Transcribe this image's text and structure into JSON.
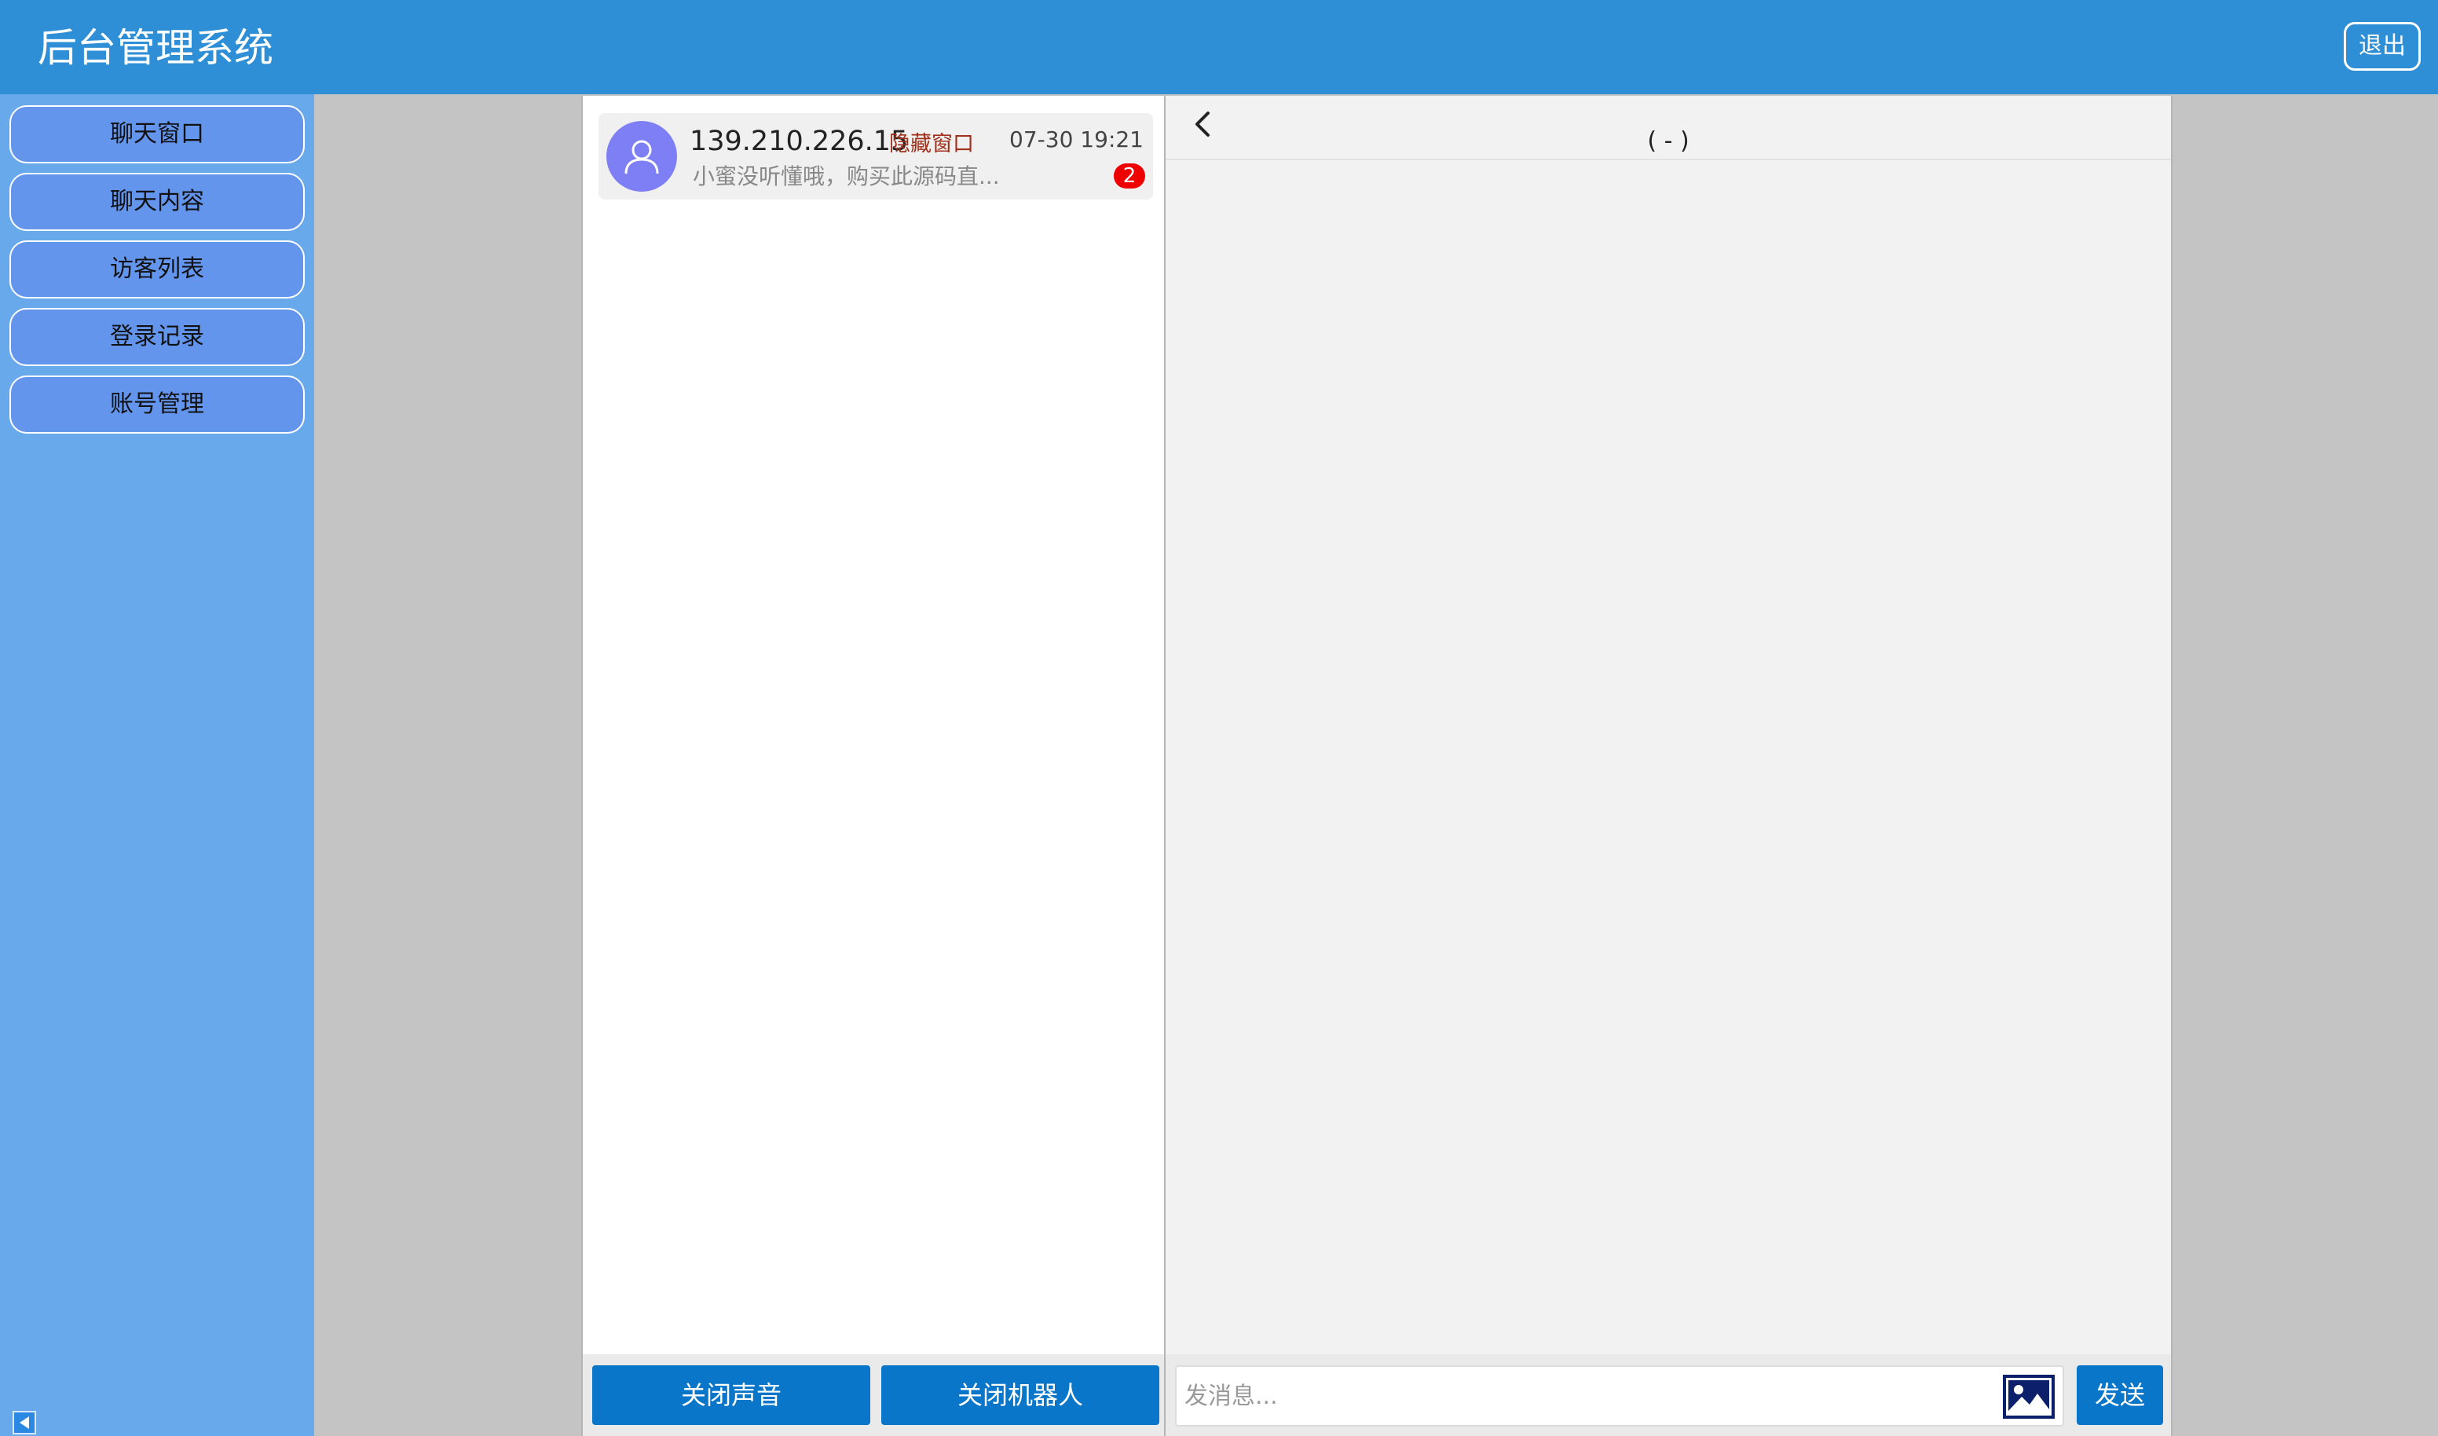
{
  "header": {
    "title": "后台管理系统",
    "logout_label": "退出"
  },
  "sidebar": {
    "items": [
      {
        "label": "聊天窗口"
      },
      {
        "label": "聊天内容"
      },
      {
        "label": "访客列表"
      },
      {
        "label": "登录记录"
      },
      {
        "label": "账号管理"
      }
    ],
    "collapse_icon": "triangle-left-icon"
  },
  "conversations": [
    {
      "ip": "139.210.226.15",
      "hide_label": "隐藏窗口",
      "time": "07-30 19:21",
      "preview": "小蜜没听懂哦，购买此源码直...",
      "unread": "2",
      "avatar_icon": "user-icon",
      "avatar_color": "#7f7ff5"
    }
  ],
  "list_footer": {
    "mute_label": "关闭声音",
    "robot_label": "关闭机器人"
  },
  "chat": {
    "title": "( - )",
    "back_icon": "chevron-left-icon",
    "input_placeholder": "发消息...",
    "image_icon": "image-icon",
    "send_label": "发送"
  },
  "colors": {
    "header_bg": "#2f8fd6",
    "sidebar_bg": "#68a9ec",
    "nav_button_bg": "#6495ed",
    "primary_button": "#0a76c9",
    "badge": "#ee0000",
    "hide_label": "#a0301a"
  }
}
